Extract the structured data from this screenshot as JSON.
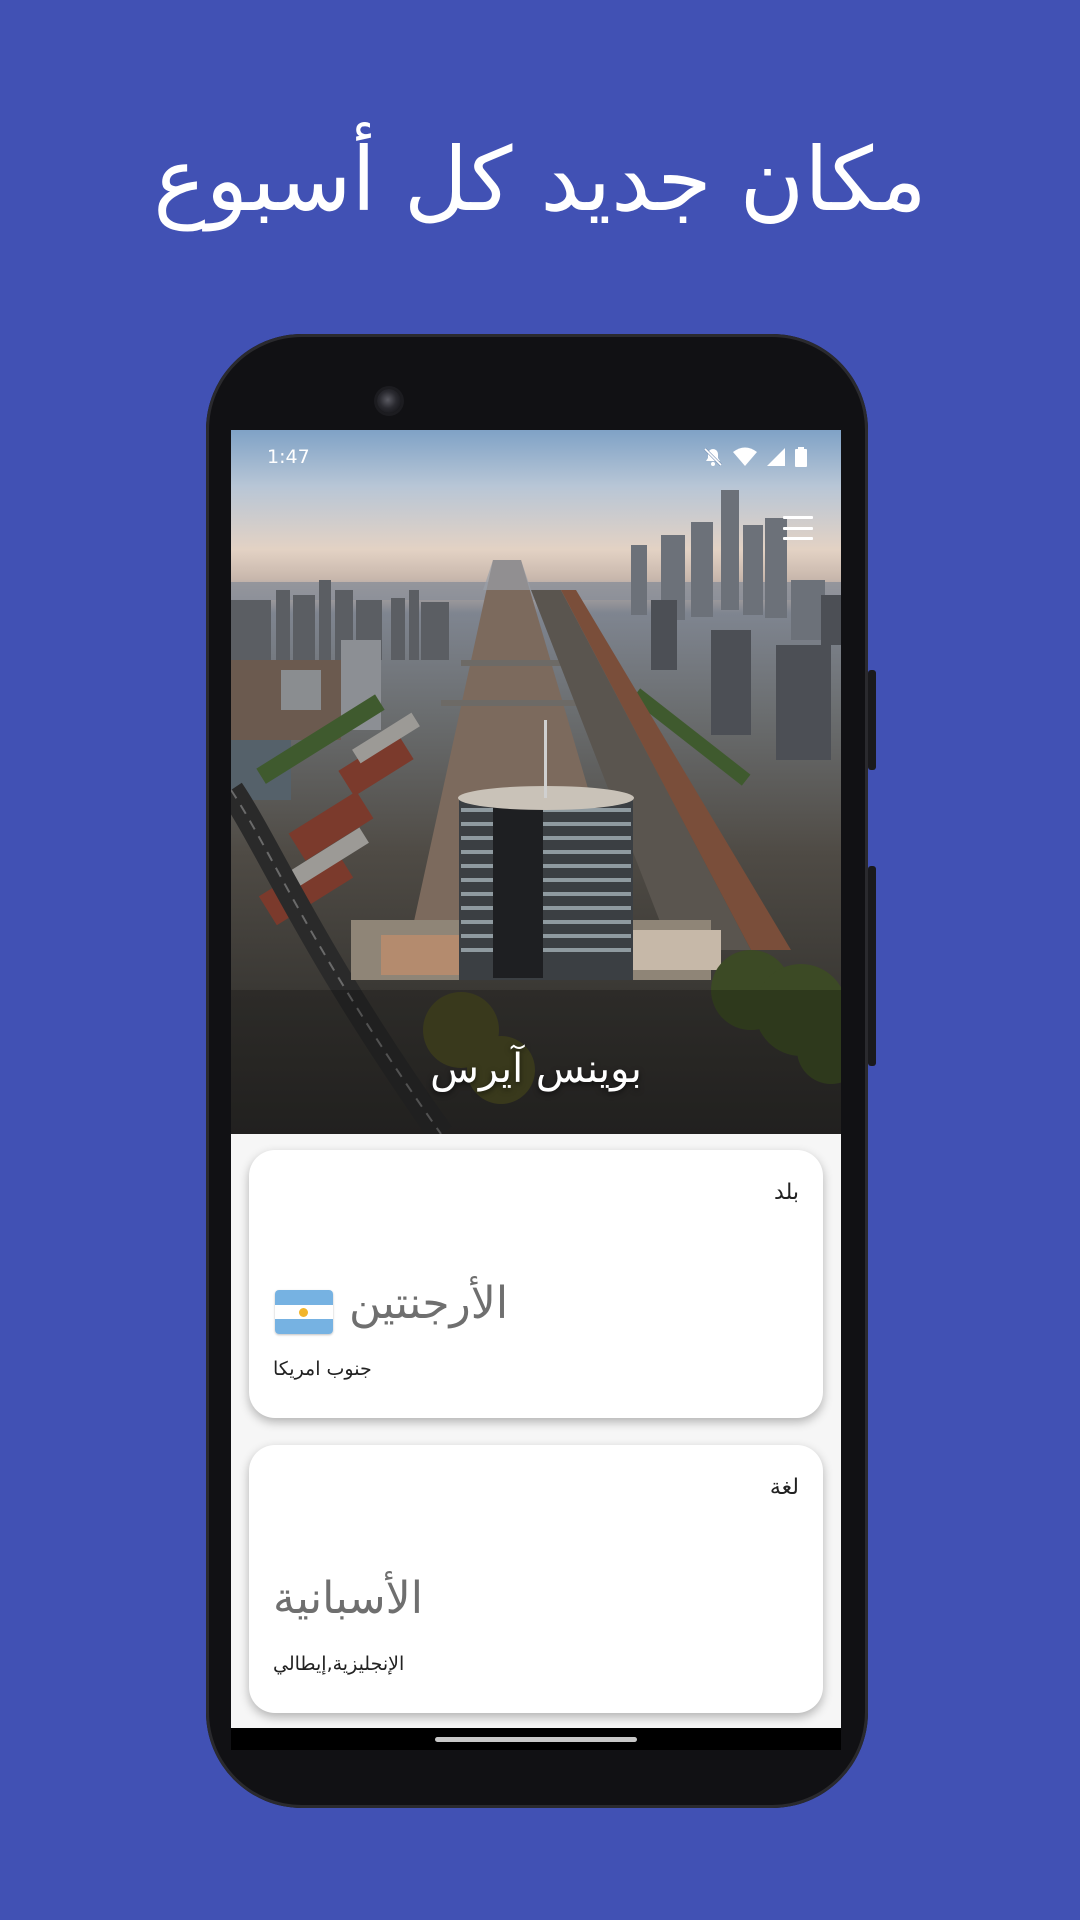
{
  "promo": {
    "title": "مكان جديد كل أسبوع"
  },
  "status_bar": {
    "time": "1:47",
    "icons": [
      "bell-off-icon",
      "wifi-icon",
      "signal-icon",
      "battery-icon"
    ]
  },
  "header": {
    "menu_icon": "hamburger-menu-icon"
  },
  "hero": {
    "city": "بوينس آيرس"
  },
  "country_card": {
    "label": "بلد",
    "value": "الأرجنتين",
    "flag_icon": "argentina-flag-icon",
    "subtitle": "جنوب امريكا"
  },
  "language_card": {
    "label": "لغة",
    "value": "الأسبانية",
    "subtitle": "الإنجليزية,إيطالي"
  },
  "colors": {
    "background": "#4151b4",
    "card": "#ffffff",
    "value_text": "#6f6f6f"
  }
}
